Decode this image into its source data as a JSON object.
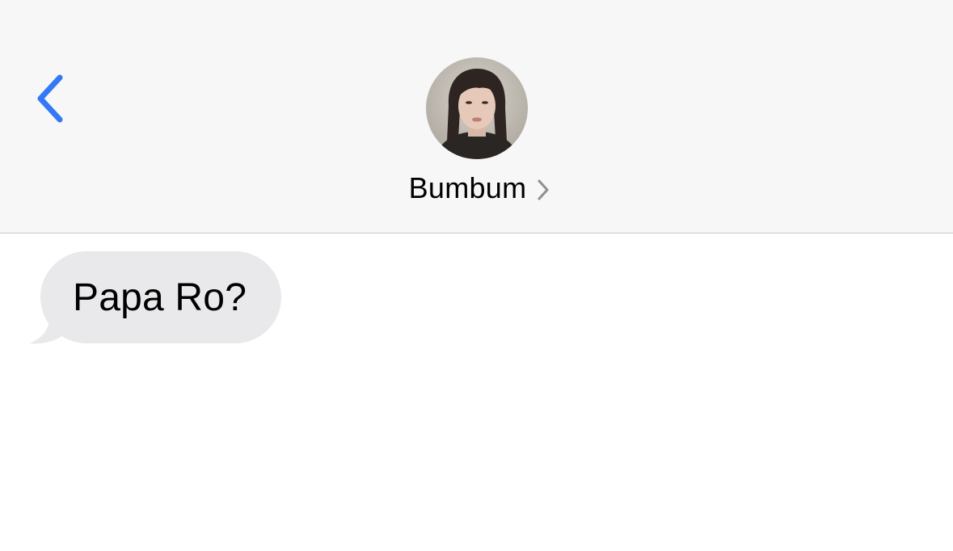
{
  "header": {
    "contact_name": "Bumbum",
    "back_icon": "chevron-left-icon",
    "detail_icon": "chevron-right-icon",
    "accent_color": "#3478f6"
  },
  "messages": [
    {
      "direction": "incoming",
      "text": "Papa Ro?",
      "bubble_color": "#e9e9eb"
    }
  ]
}
